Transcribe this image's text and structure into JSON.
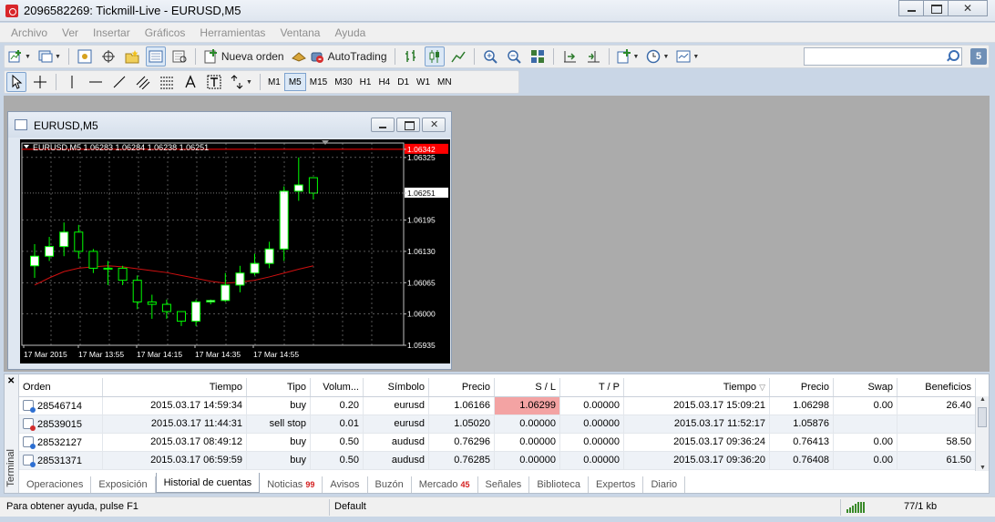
{
  "window": {
    "title": "2096582269: Tickmill-Live - EURUSD,M5"
  },
  "menu": [
    "Archivo",
    "Ver",
    "Insertar",
    "Gráficos",
    "Herramientas",
    "Ventana",
    "Ayuda"
  ],
  "toolbar": {
    "new_order_label": "Nueva orden",
    "autotrading_label": "AutoTrading",
    "timeframes": [
      "M1",
      "M5",
      "M15",
      "M30",
      "H1",
      "H4",
      "D1",
      "W1",
      "MN"
    ],
    "active_timeframe": "M5",
    "search_placeholder": "",
    "badge": "5"
  },
  "chart_window": {
    "title": "EURUSD,M5",
    "header": "EURUSD,M5  1.06283 1.06284 1.06238 1.06251",
    "price_labels": [
      "1.06342",
      "1.06325",
      "1.06251",
      "1.06195",
      "1.06130",
      "1.06065",
      "1.06000",
      "1.05935"
    ],
    "time_labels": [
      "17 Mar 2015",
      "17 Mar 13:55",
      "17 Mar 14:15",
      "17 Mar 14:35",
      "17 Mar 14:55"
    ]
  },
  "chart_data": {
    "type": "candlestick",
    "symbol": "EURUSD",
    "timeframe": "M5",
    "ylim": [
      1.05935,
      1.06355
    ],
    "ask_line": 1.06342,
    "current_price": 1.06251,
    "candles": [
      {
        "o": 1.061,
        "h": 1.06145,
        "l": 1.06075,
        "c": 1.0612
      },
      {
        "o": 1.0612,
        "h": 1.0616,
        "l": 1.0611,
        "c": 1.0614
      },
      {
        "o": 1.0614,
        "h": 1.0619,
        "l": 1.0612,
        "c": 1.0617
      },
      {
        "o": 1.0617,
        "h": 1.06185,
        "l": 1.06115,
        "c": 1.0613
      },
      {
        "o": 1.0613,
        "h": 1.06135,
        "l": 1.06085,
        "c": 1.06095
      },
      {
        "o": 1.06095,
        "h": 1.0611,
        "l": 1.0606,
        "c": 1.06095
      },
      {
        "o": 1.06095,
        "h": 1.061,
        "l": 1.0606,
        "c": 1.0607
      },
      {
        "o": 1.0607,
        "h": 1.0608,
        "l": 1.0601,
        "c": 1.06025
      },
      {
        "o": 1.06025,
        "h": 1.0604,
        "l": 1.0599,
        "c": 1.0602
      },
      {
        "o": 1.0602,
        "h": 1.0603,
        "l": 1.0599,
        "c": 1.06005
      },
      {
        "o": 1.06005,
        "h": 1.06005,
        "l": 1.05975,
        "c": 1.05985
      },
      {
        "o": 1.05985,
        "h": 1.0603,
        "l": 1.05975,
        "c": 1.06025
      },
      {
        "o": 1.06025,
        "h": 1.0603,
        "l": 1.0602,
        "c": 1.06028
      },
      {
        "o": 1.06028,
        "h": 1.06085,
        "l": 1.06025,
        "c": 1.0606
      },
      {
        "o": 1.0606,
        "h": 1.061,
        "l": 1.06045,
        "c": 1.06085
      },
      {
        "o": 1.06085,
        "h": 1.06125,
        "l": 1.0608,
        "c": 1.06105
      },
      {
        "o": 1.06105,
        "h": 1.0615,
        "l": 1.06095,
        "c": 1.06135
      },
      {
        "o": 1.06135,
        "h": 1.06265,
        "l": 1.0611,
        "c": 1.06255
      },
      {
        "o": 1.06255,
        "h": 1.06325,
        "l": 1.06235,
        "c": 1.06268
      },
      {
        "o": 1.06283,
        "h": 1.06284,
        "l": 1.06238,
        "c": 1.06251
      }
    ],
    "ma": [
      1.0606,
      1.06075,
      1.06088,
      1.06095,
      1.06098,
      1.061,
      1.06098,
      1.06094,
      1.0609,
      1.06086,
      1.0608,
      1.06074,
      1.06068,
      1.06064,
      1.06066,
      1.0607,
      1.06077,
      1.06085,
      1.06093,
      1.061
    ],
    "grid": true
  },
  "terminal": {
    "side_label": "Terminal",
    "columns": [
      "Orden",
      "Tiempo",
      "Tipo",
      "Volum...",
      "Símbolo",
      "Precio",
      "S / L",
      "T / P",
      "Tiempo",
      "Precio",
      "Swap",
      "Beneficios"
    ],
    "rows": [
      {
        "orden": "28546714",
        "tiempo": "2015.03.17 14:59:34",
        "tipo": "buy",
        "volumen": "0.20",
        "simbolo": "eurusd",
        "precio": "1.06166",
        "sl": "1.06299",
        "tp": "0.00000",
        "tiempo_cierre": "2015.03.17 15:09:21",
        "precio_cierre": "1.06298",
        "swap": "0.00",
        "beneficios": "26.40",
        "kind": "buy"
      },
      {
        "orden": "28539015",
        "tiempo": "2015.03.17 11:44:31",
        "tipo": "sell stop",
        "volumen": "0.01",
        "simbolo": "eurusd",
        "precio": "1.05020",
        "sl": "0.00000",
        "tp": "0.00000",
        "tiempo_cierre": "2015.03.17 11:52:17",
        "precio_cierre": "1.05876",
        "swap": "",
        "beneficios": "",
        "kind": "stop"
      },
      {
        "orden": "28532127",
        "tiempo": "2015.03.17 08:49:12",
        "tipo": "buy",
        "volumen": "0.50",
        "simbolo": "audusd",
        "precio": "0.76296",
        "sl": "0.00000",
        "tp": "0.00000",
        "tiempo_cierre": "2015.03.17 09:36:24",
        "precio_cierre": "0.76413",
        "swap": "0.00",
        "beneficios": "58.50",
        "kind": "buy"
      },
      {
        "orden": "28531371",
        "tiempo": "2015.03.17 06:59:59",
        "tipo": "buy",
        "volumen": "0.50",
        "simbolo": "audusd",
        "precio": "0.76285",
        "sl": "0.00000",
        "tp": "0.00000",
        "tiempo_cierre": "2015.03.17 09:36:20",
        "precio_cierre": "0.76408",
        "swap": "0.00",
        "beneficios": "61.50",
        "kind": "buy"
      }
    ],
    "tabs": [
      {
        "label": "Operaciones"
      },
      {
        "label": "Exposición"
      },
      {
        "label": "Historial de cuentas",
        "active": true
      },
      {
        "label": "Noticias",
        "badge": "99"
      },
      {
        "label": "Avisos"
      },
      {
        "label": "Buzón"
      },
      {
        "label": "Mercado",
        "badge": "45"
      },
      {
        "label": "Señales"
      },
      {
        "label": "Biblioteca"
      },
      {
        "label": "Expertos"
      },
      {
        "label": "Diario"
      }
    ]
  },
  "status": {
    "help": "Para obtener ayuda, pulse F1",
    "profile": "Default",
    "traffic": "77/1 kb"
  },
  "colors": {
    "bull_candle": "#ffffff",
    "bear_candle": "#000000",
    "candle_outline": "#00ff00",
    "ma_line": "#d01010",
    "ask_line": "#ff0000",
    "sl_highlight": "#f3a3a3"
  }
}
